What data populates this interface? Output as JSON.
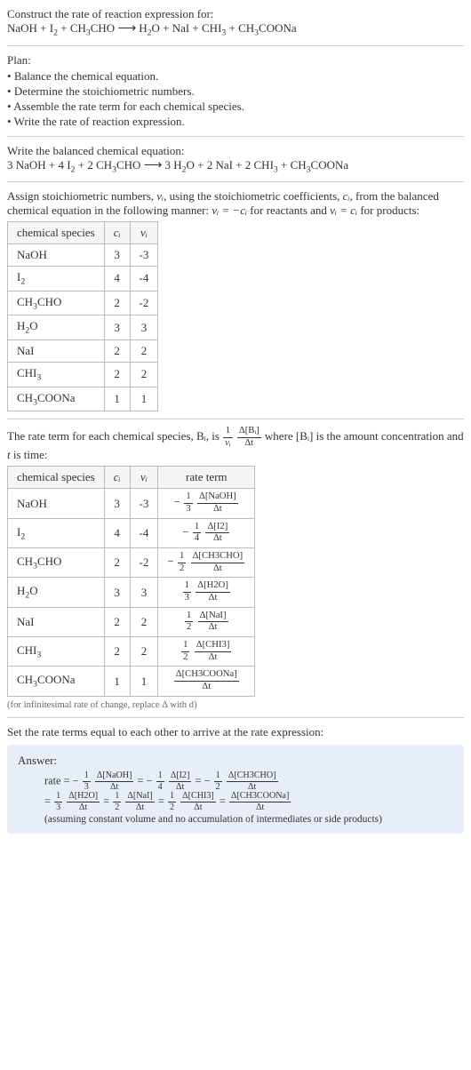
{
  "header": {
    "construct": "Construct the rate of reaction expression for:",
    "equation_unbalanced": "NaOH + I₂ + CH₃CHO ⟶ H₂O + NaI + CHI₃ + CH₃COONa"
  },
  "plan": {
    "title": "Plan:",
    "items": [
      "Balance the chemical equation.",
      "Determine the stoichiometric numbers.",
      "Assemble the rate term for each chemical species.",
      "Write the rate of reaction expression."
    ]
  },
  "balanced": {
    "title": "Write the balanced chemical equation:",
    "equation": "3 NaOH + 4 I₂ + 2 CH₃CHO ⟶ 3 H₂O + 2 NaI + 2 CHI₃ + CH₃COONa"
  },
  "stoich_intro": {
    "text_pre": "Assign stoichiometric numbers, ",
    "nu_i": "νᵢ",
    "text_mid1": ", using the stoichiometric coefficients, ",
    "c_i": "cᵢ",
    "text_mid2": ", from the balanced chemical equation in the following manner: ",
    "rel1": "νᵢ = −cᵢ",
    "text_mid3": " for reactants and ",
    "rel2": "νᵢ = cᵢ",
    "text_end": " for products:"
  },
  "table1": {
    "headers": [
      "chemical species",
      "cᵢ",
      "νᵢ"
    ],
    "rows": [
      {
        "species": "NaOH",
        "c": "3",
        "nu": "-3"
      },
      {
        "species": "I₂",
        "c": "4",
        "nu": "-4"
      },
      {
        "species": "CH₃CHO",
        "c": "2",
        "nu": "-2"
      },
      {
        "species": "H₂O",
        "c": "3",
        "nu": "3"
      },
      {
        "species": "NaI",
        "c": "2",
        "nu": "2"
      },
      {
        "species": "CHI₃",
        "c": "2",
        "nu": "2"
      },
      {
        "species": "CH₃COONa",
        "c": "1",
        "nu": "1"
      }
    ]
  },
  "rate_intro": {
    "text_pre": "The rate term for each chemical species, Bᵢ, is ",
    "frac_coeff_num": "1",
    "frac_coeff_den": "νᵢ",
    "frac_d_num": "Δ[Bᵢ]",
    "frac_d_den": "Δt",
    "text_mid": " where [Bᵢ] is the amount concentration and ",
    "t": "t",
    "text_end": " is time:"
  },
  "table2": {
    "headers": [
      "chemical species",
      "cᵢ",
      "νᵢ",
      "rate term"
    ],
    "rows": [
      {
        "species": "NaOH",
        "c": "3",
        "nu": "-3",
        "sign": "−",
        "cn": "1",
        "cd": "3",
        "dnum": "Δ[NaOH]",
        "dden": "Δt"
      },
      {
        "species": "I₂",
        "c": "4",
        "nu": "-4",
        "sign": "−",
        "cn": "1",
        "cd": "4",
        "dnum": "Δ[I2]",
        "dden": "Δt"
      },
      {
        "species": "CH₃CHO",
        "c": "2",
        "nu": "-2",
        "sign": "−",
        "cn": "1",
        "cd": "2",
        "dnum": "Δ[CH3CHO]",
        "dden": "Δt"
      },
      {
        "species": "H₂O",
        "c": "3",
        "nu": "3",
        "sign": "",
        "cn": "1",
        "cd": "3",
        "dnum": "Δ[H2O]",
        "dden": "Δt"
      },
      {
        "species": "NaI",
        "c": "2",
        "nu": "2",
        "sign": "",
        "cn": "1",
        "cd": "2",
        "dnum": "Δ[NaI]",
        "dden": "Δt"
      },
      {
        "species": "CHI₃",
        "c": "2",
        "nu": "2",
        "sign": "",
        "cn": "1",
        "cd": "2",
        "dnum": "Δ[CHI3]",
        "dden": "Δt"
      },
      {
        "species": "CH₃COONa",
        "c": "1",
        "nu": "1",
        "sign": "",
        "cn": "",
        "cd": "",
        "dnum": "Δ[CH3COONa]",
        "dden": "Δt"
      }
    ]
  },
  "infinitesimal_note": "(for infinitesimal rate of change, replace Δ with d)",
  "final_intro": "Set the rate terms equal to each other to arrive at the rate expression:",
  "answer": {
    "label": "Answer:",
    "rate_prefix": "rate = ",
    "terms": [
      {
        "sign": "−",
        "cn": "1",
        "cd": "3",
        "dnum": "Δ[NaOH]",
        "dden": "Δt"
      },
      {
        "sign": "−",
        "cn": "1",
        "cd": "4",
        "dnum": "Δ[I2]",
        "dden": "Δt"
      },
      {
        "sign": "−",
        "cn": "1",
        "cd": "2",
        "dnum": "Δ[CH3CHO]",
        "dden": "Δt"
      },
      {
        "sign": "",
        "cn": "1",
        "cd": "3",
        "dnum": "Δ[H2O]",
        "dden": "Δt"
      },
      {
        "sign": "",
        "cn": "1",
        "cd": "2",
        "dnum": "Δ[NaI]",
        "dden": "Δt"
      },
      {
        "sign": "",
        "cn": "1",
        "cd": "2",
        "dnum": "Δ[CHI3]",
        "dden": "Δt"
      },
      {
        "sign": "",
        "cn": "",
        "cd": "",
        "dnum": "Δ[CH3COONa]",
        "dden": "Δt"
      }
    ],
    "assume": "(assuming constant volume and no accumulation of intermediates or side products)"
  }
}
